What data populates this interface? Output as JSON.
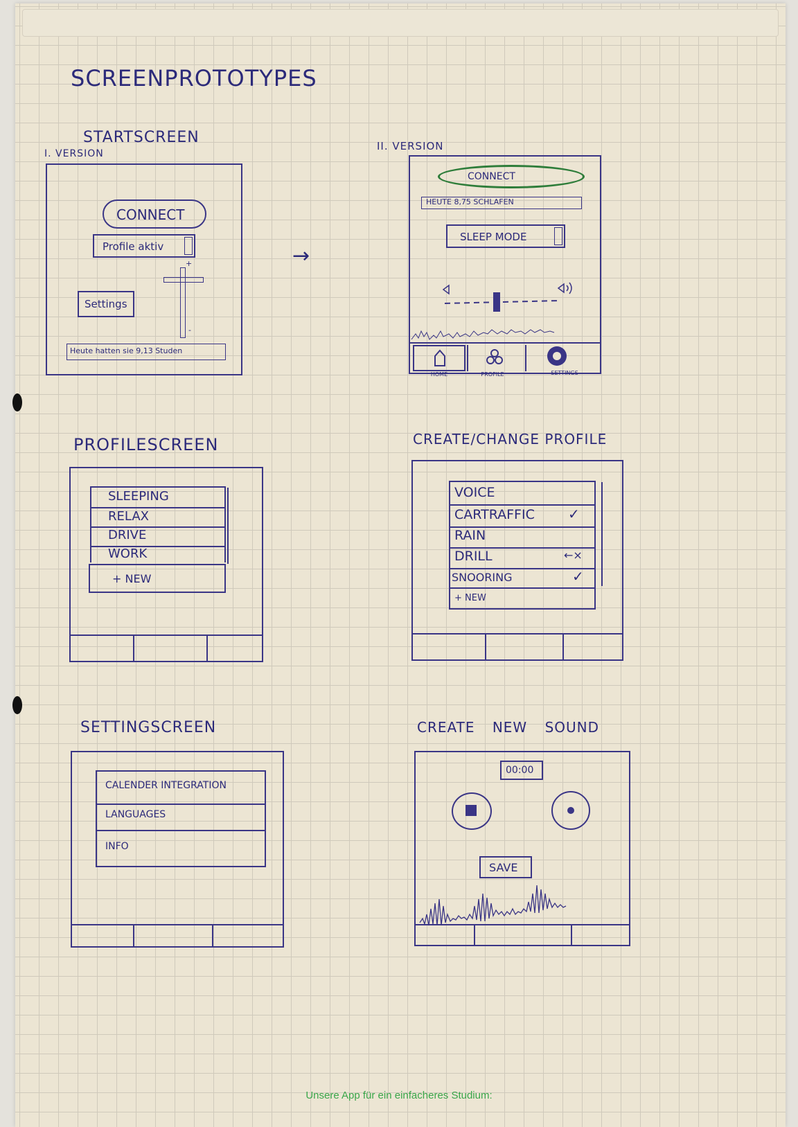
{
  "title": "SCREENPROTOTYPES",
  "startscreen": {
    "heading": "STARTSCREEN",
    "v1": {
      "label": "I. VERSION",
      "connect": "CONNECT",
      "profile_select": "Profile aktiv",
      "settings": "Settings",
      "status": "Heute hatten sie 9,13 Studen"
    },
    "arrow": "→",
    "v2": {
      "label": "II. VERSION",
      "connect": "CONNECT",
      "status": "HEUTE 8,75 SCHLAFEN",
      "mode_select": "SLEEP MODE",
      "nav": [
        "HOME",
        "PROFILE",
        "SETTINGS"
      ]
    }
  },
  "profilescreen": {
    "heading": "PROFILESCREEN",
    "items": [
      "SLEEPING",
      "RELAX",
      "DRIVE",
      "WORK"
    ],
    "new": "+ NEW"
  },
  "create_profile": {
    "heading": "CREATE/CHANGE PROFILE",
    "items": [
      {
        "label": "VOICE",
        "mark": ""
      },
      {
        "label": "CARTRAFFIC",
        "mark": "✓"
      },
      {
        "label": "RAIN",
        "mark": ""
      },
      {
        "label": "DRILL",
        "mark": "←×"
      },
      {
        "label": "SNOORING",
        "mark": "✓"
      }
    ],
    "new": "+ NEW"
  },
  "settingscreen": {
    "heading": "SETTINGSCREEN",
    "items": [
      "CALENDER INTEGRATION",
      "LANGUAGES",
      "INFO"
    ]
  },
  "create_sound": {
    "heading": "CREATE NEW SOUND",
    "timer": "00:00",
    "save": "SAVE"
  },
  "footer": "Unsere App für ein einfacheres Studium:",
  "colors": {
    "ink": "#2c2a7a",
    "green_ink": "#2e7d3a",
    "paper": "#ece5d3",
    "footer": "#3aa64a"
  }
}
